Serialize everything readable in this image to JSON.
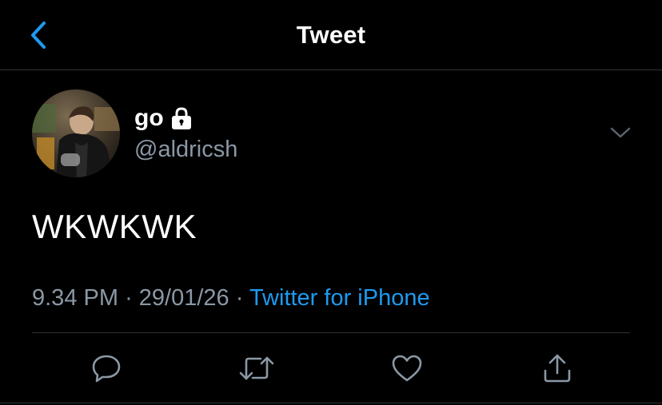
{
  "header": {
    "title": "Tweet",
    "back_icon": "chevron-left-icon"
  },
  "tweet": {
    "author": {
      "display_name": "go",
      "username": "@aldricsh",
      "protected_icon": "lock-icon"
    },
    "text": "WKWKWK",
    "time": "9.34 PM",
    "separator": "·",
    "date": "29/01/26",
    "source": "Twitter for iPhone"
  },
  "actions": [
    {
      "name": "reply",
      "icon": "reply-icon"
    },
    {
      "name": "retweet",
      "icon": "retweet-icon"
    },
    {
      "name": "like",
      "icon": "heart-icon"
    },
    {
      "name": "share",
      "icon": "share-icon"
    }
  ],
  "colors": {
    "background": "#000000",
    "accent": "#1d9bf0",
    "secondary_text": "#8b98a5",
    "divider": "#2f3336"
  }
}
